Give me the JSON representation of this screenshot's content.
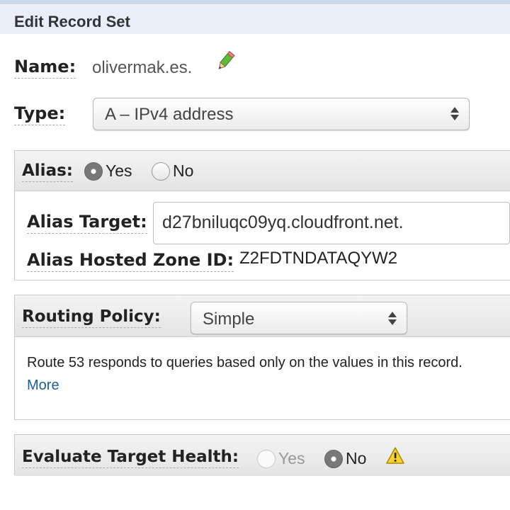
{
  "header": {
    "title": "Edit Record Set"
  },
  "name": {
    "label": "Name:",
    "value": "olivermak.es.",
    "edit_icon": "pencil-icon"
  },
  "type": {
    "label": "Type:",
    "selected": "A – IPv4 address"
  },
  "alias": {
    "label": "Alias:",
    "options": [
      "Yes",
      "No"
    ],
    "selected": "Yes",
    "target_label": "Alias Target:",
    "target_value": "d27bniluqc09yq.cloudfront.net.",
    "zone_label": "Alias Hosted Zone ID:",
    "zone_value": "Z2FDTNDATAQYW2"
  },
  "routing": {
    "label": "Routing Policy:",
    "selected": "Simple",
    "description": "Route 53 responds to queries based only on the values in this record.",
    "more_link": "More",
    "link_color": "#1a5e9e"
  },
  "health": {
    "label": "Evaluate Target Health:",
    "options": [
      "Yes",
      "No"
    ],
    "selected": "No",
    "warning_icon": "warning-icon"
  }
}
